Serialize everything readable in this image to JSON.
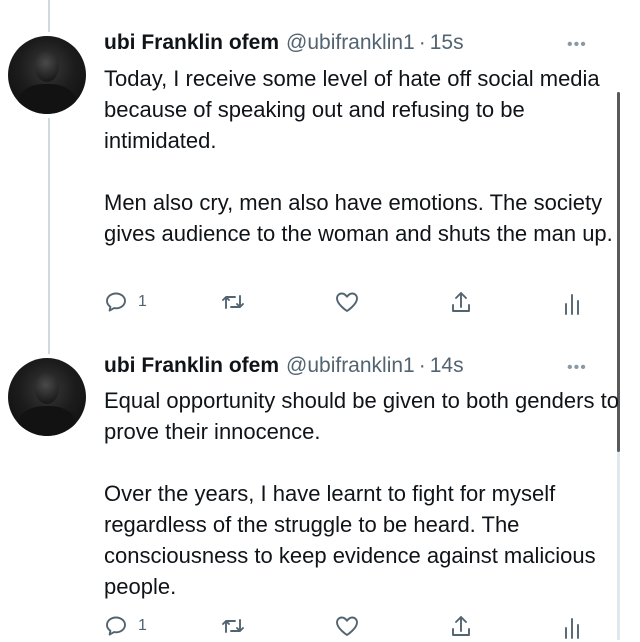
{
  "tweets": [
    {
      "name": "ubi Franklin ofem",
      "handle": "@ubifranklin1",
      "separator": "·",
      "time": "15s",
      "more_glyph": "•••",
      "paragraphs": [
        "Today, I receive some level of hate off social media because of speaking out and refusing to be intimidated.",
        "Men also cry, men also have emotions. The society gives audience to the woman and shuts the man up."
      ],
      "reply_count": "1"
    },
    {
      "name": "ubi Franklin ofem",
      "handle": "@ubifranklin1",
      "separator": "·",
      "time": "14s",
      "more_glyph": "•••",
      "paragraphs": [
        "Equal opportunity should be given to both genders to prove their innocence.",
        "Over the years, I have learnt to fight for myself regardless of the struggle to be heard. The consciousness to keep evidence against malicious people."
      ],
      "reply_count": "1"
    }
  ],
  "icons": {
    "reply": "reply-icon",
    "retweet": "retweet-icon",
    "like": "heart-icon",
    "share": "share-icon",
    "analytics": "analytics-icon"
  },
  "colors": {
    "text": "#0f1419",
    "secondary": "#536471",
    "thread_line": "#cfd9de"
  }
}
